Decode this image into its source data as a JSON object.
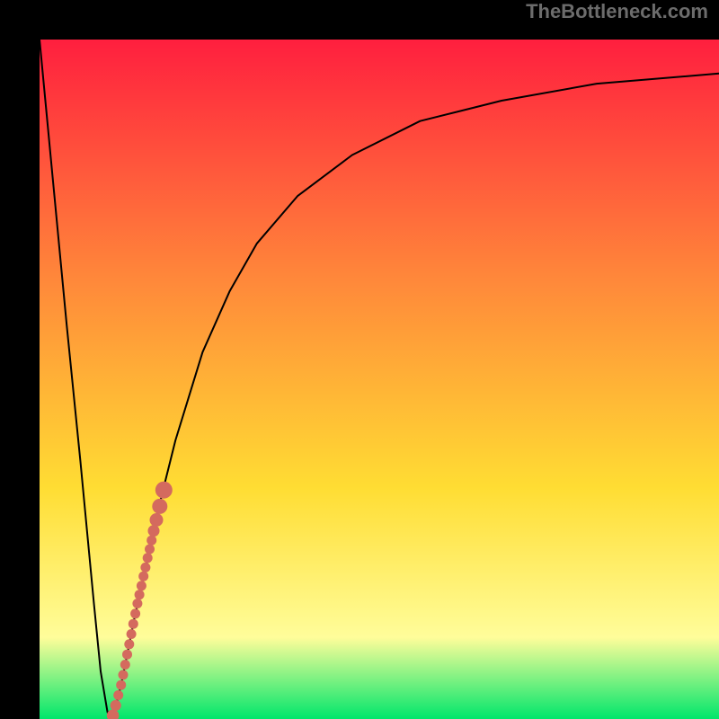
{
  "attribution": "TheBottleneck.com",
  "colors": {
    "gradient_top": "#ff1f3e",
    "gradient_mid_high": "#ff873a",
    "gradient_mid": "#ffdd33",
    "gradient_low": "#fffd9a",
    "gradient_bottom": "#00e66b",
    "curve": "#000000",
    "dot": "#d46a5e",
    "background": "#000000",
    "attribution_text": "#6c6c6c"
  },
  "chart_data": {
    "type": "line",
    "title": "",
    "xlabel": "",
    "ylabel": "",
    "xlim": [
      0,
      100
    ],
    "ylim": [
      0,
      100
    ],
    "grid": false,
    "legend": false,
    "series": [
      {
        "name": "bottleneck-curve",
        "x": [
          0,
          2,
          4,
          6,
          8,
          9,
          10,
          10.5,
          11,
          12,
          13,
          14,
          16,
          18,
          20,
          24,
          28,
          32,
          38,
          46,
          56,
          68,
          82,
          100
        ],
        "values": [
          100,
          79,
          58,
          38,
          17,
          7,
          1,
          0,
          1,
          5,
          10,
          15,
          24,
          33,
          41,
          54,
          63,
          70,
          77,
          83,
          88,
          91,
          93.5,
          95
        ]
      }
    ],
    "highlight_points": {
      "name": "selected-range",
      "x": [
        10.8,
        11.2,
        11.6,
        12.0,
        12.3,
        12.6,
        12.9,
        13.2,
        13.5,
        13.8,
        14.1,
        14.4,
        14.7,
        15.0,
        15.3,
        15.6,
        15.9,
        16.2,
        16.5,
        16.8,
        17.2,
        17.7,
        18.3
      ],
      "values": [
        0.5,
        2,
        3.5,
        5,
        6.5,
        8,
        9.5,
        11,
        12.5,
        14,
        15.5,
        17,
        18.3,
        19.6,
        21,
        22.3,
        23.7,
        25,
        26.3,
        27.7,
        29.3,
        31.3,
        33.7
      ]
    }
  }
}
